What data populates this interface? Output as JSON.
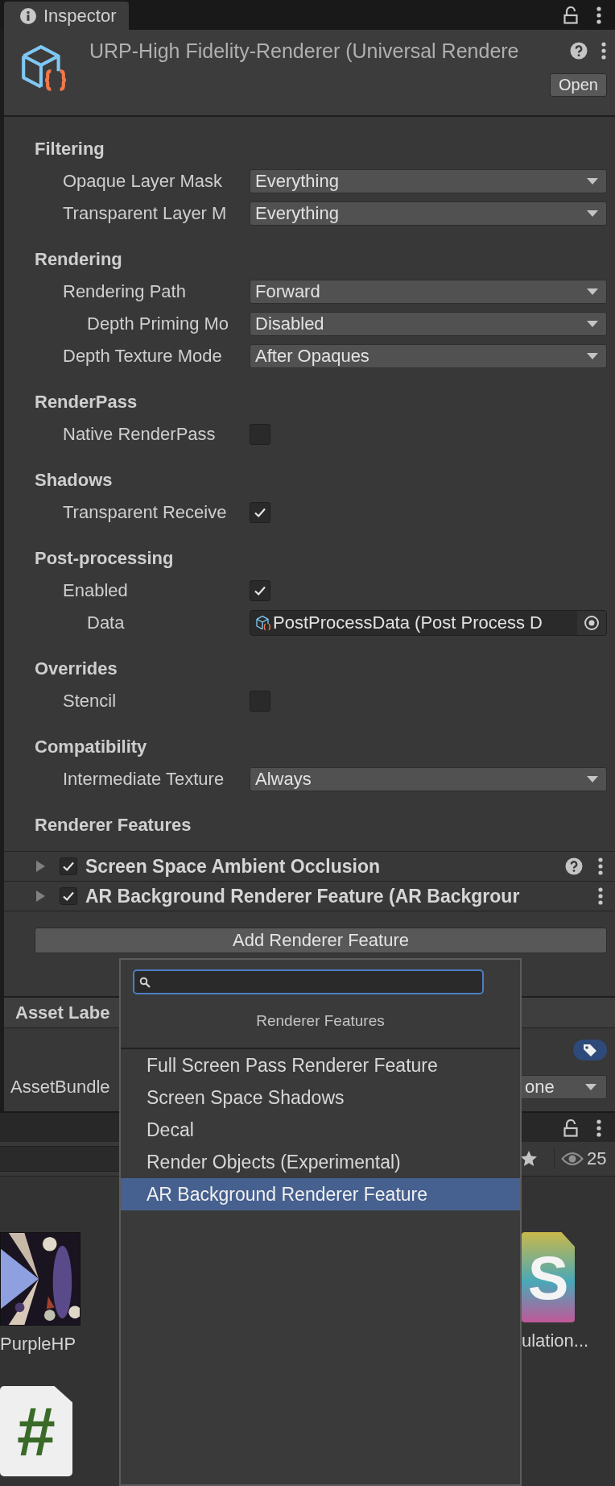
{
  "inspector_tab": {
    "label": "Inspector"
  },
  "asset": {
    "title": "URP-High Fidelity-Renderer (Universal Rendere",
    "open_button": "Open"
  },
  "sections": [
    {
      "title": "Filtering",
      "fields": [
        {
          "kind": "dropdown",
          "label": "Opaque Layer Mask",
          "value": "Everything"
        },
        {
          "kind": "dropdown",
          "label": "Transparent Layer M",
          "value": "Everything"
        }
      ]
    },
    {
      "title": "Rendering",
      "fields": [
        {
          "kind": "dropdown",
          "label": "Rendering Path",
          "value": "Forward",
          "children": [
            {
              "kind": "dropdown",
              "label": "Depth Priming Mo",
              "value": "Disabled"
            }
          ]
        },
        {
          "kind": "dropdown",
          "label": "Depth Texture Mode",
          "value": "After Opaques"
        }
      ]
    },
    {
      "title": "RenderPass",
      "fields": [
        {
          "kind": "checkbox",
          "label": "Native RenderPass",
          "checked": false
        }
      ]
    },
    {
      "title": "Shadows",
      "fields": [
        {
          "kind": "checkbox",
          "label": "Transparent Receive",
          "checked": true
        }
      ]
    },
    {
      "title": "Post-processing",
      "fields": [
        {
          "kind": "checkbox",
          "label": "Enabled",
          "checked": true,
          "children": [
            {
              "kind": "object",
              "label": "Data",
              "value": "PostProcessData (Post Process D"
            }
          ]
        }
      ]
    },
    {
      "title": "Overrides",
      "fields": [
        {
          "kind": "checkbox",
          "label": "Stencil",
          "checked": false
        }
      ]
    },
    {
      "title": "Compatibility",
      "fields": [
        {
          "kind": "dropdown",
          "label": "Intermediate Texture",
          "value": "Always"
        }
      ]
    }
  ],
  "renderer_features": {
    "title": "Renderer Features",
    "items": [
      {
        "label": "Screen Space Ambient Occlusion",
        "enabled": true,
        "expanded": false,
        "has_help": true
      },
      {
        "label": "AR Background Renderer Feature (AR Backgrour",
        "enabled": true,
        "expanded": false,
        "has_help": false
      }
    ],
    "add_button": "Add Renderer Feature"
  },
  "asset_labels": {
    "title": "Asset Labe",
    "bundle_label": "AssetBundle",
    "bundle_value": "one"
  },
  "project": {
    "count": "25",
    "assets": [
      {
        "kind": "picture",
        "label": "PurpleHP"
      },
      {
        "kind": "shader",
        "label": "ulation...",
        "glyph": "S"
      },
      {
        "kind": "script",
        "glyph": "#"
      }
    ]
  },
  "popup": {
    "title": "Renderer Features",
    "items": [
      {
        "label": "Full Screen Pass Renderer Feature",
        "selected": false
      },
      {
        "label": "Screen Space Shadows",
        "selected": false
      },
      {
        "label": "Decal",
        "selected": false
      },
      {
        "label": "Render Objects (Experimental)",
        "selected": false
      },
      {
        "label": "AR Background Renderer Feature",
        "selected": true
      }
    ]
  }
}
